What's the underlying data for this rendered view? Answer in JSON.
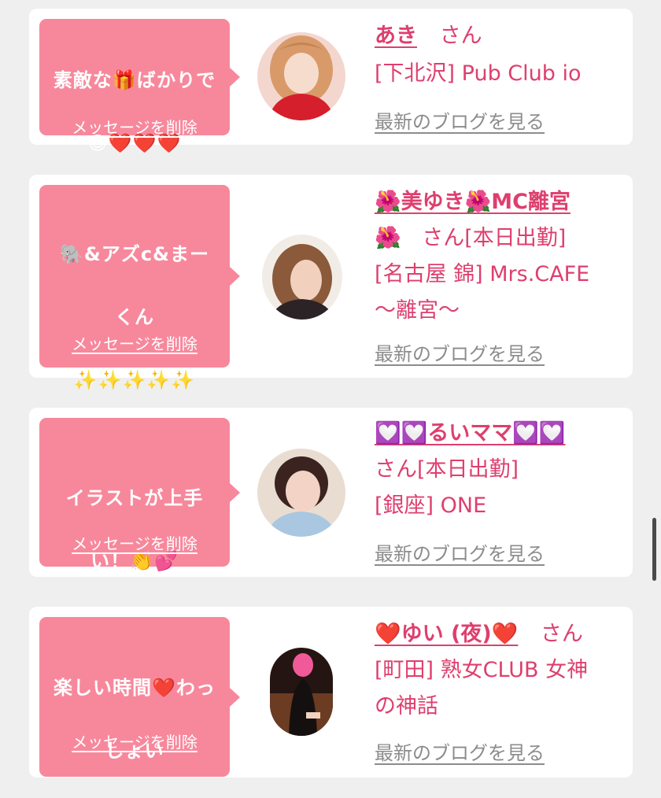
{
  "cards": [
    {
      "message_line1": "素敵な🎁ばかりで",
      "message_line2": "😍❤️❤️❤️",
      "delete_label": "メッセージを削除",
      "name": "あき",
      "suffix": "さん",
      "shop": "[下北沢] Pub Club io",
      "blog_label": "最新のブログを見る"
    },
    {
      "message_line1": "🐘&アズc&まー",
      "message_line2": "くん",
      "message_line3": "✨✨✨✨✨",
      "delete_label": "メッセージを削除",
      "name": "🌺美ゆき🌺MC離宮",
      "name_tail": "🌺",
      "suffix": "さん[本日出勤]",
      "shop": "[名古屋 錦] Mrs.CAFE",
      "shop_line2": "〜離宮〜",
      "blog_label": "最新のブログを見る"
    },
    {
      "message_line1": "イラストが上手",
      "message_line2": "い！👏💕",
      "delete_label": "メッセージを削除",
      "name": "💟💟るいママ💟💟",
      "suffix": "さん[本日出勤]",
      "shop": "[銀座] ONE",
      "blog_label": "最新のブログを見る"
    },
    {
      "message_line1": "楽しい時間❤️わっ",
      "message_line2": "しょい",
      "delete_label": "メッセージを削除",
      "name": "❤️ゆい (夜)❤️",
      "suffix": "さん",
      "shop": "[町田] 熟女CLUB 女神",
      "shop_line2": "の神話",
      "blog_label": "最新のブログを見る"
    }
  ],
  "colors": {
    "bubble": "#f7889c",
    "accent": "#de3f6e",
    "link_gray": "#8c8c8c",
    "background": "#efefef"
  }
}
